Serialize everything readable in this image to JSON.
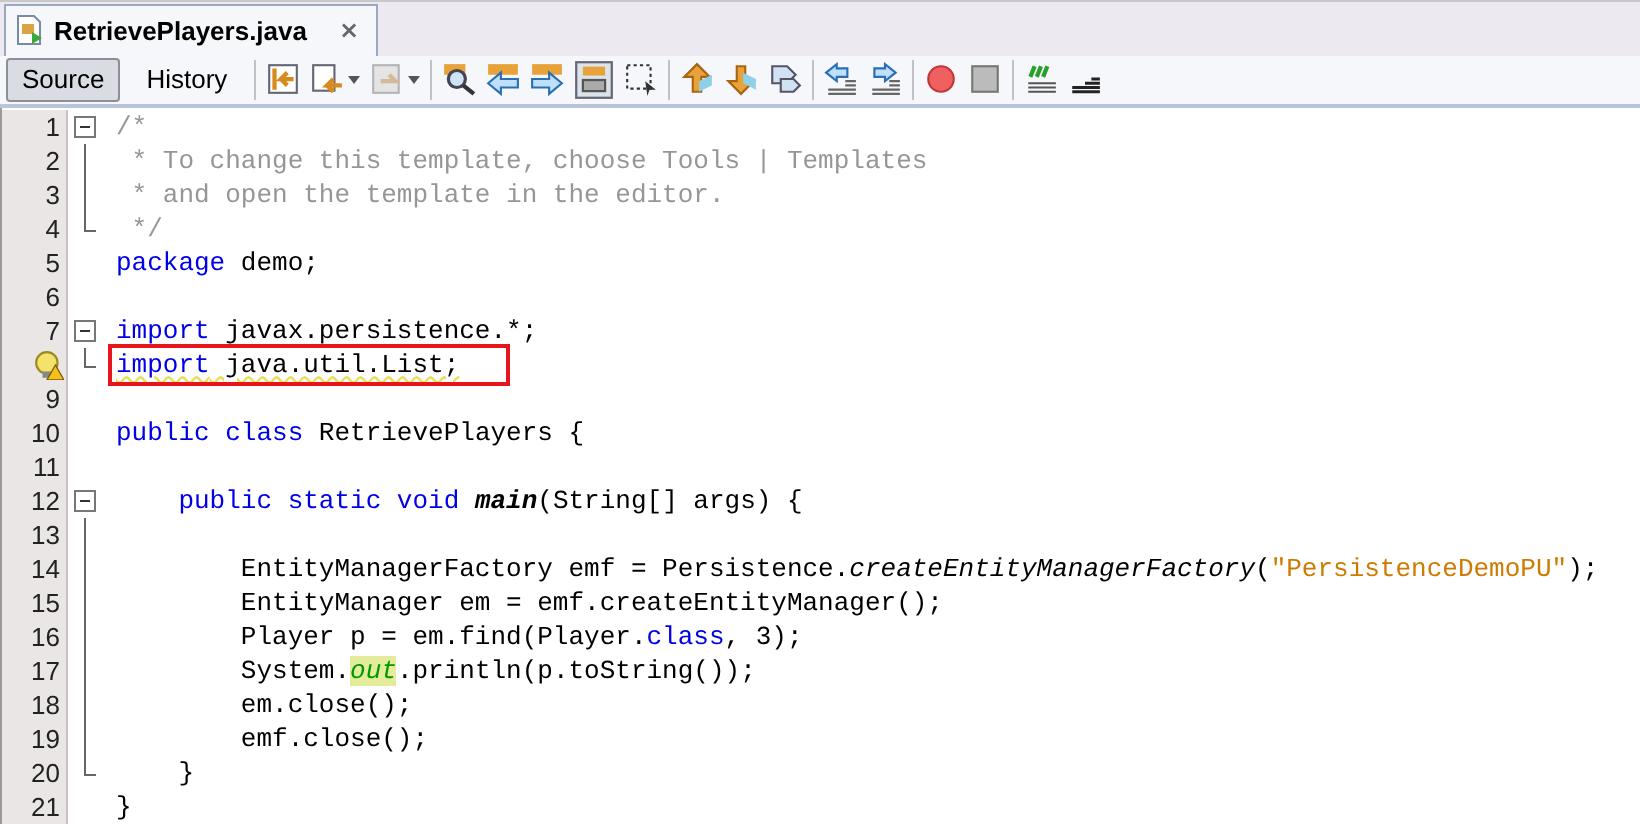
{
  "tab": {
    "title": "RetrievePlayers.java",
    "close": "×"
  },
  "view_buttons": [
    {
      "label": "Source",
      "selected": true
    },
    {
      "label": "History",
      "selected": false
    }
  ],
  "lines": [
    {
      "number": "1",
      "kind": "fold-start",
      "tokens": [
        {
          "kind": "comment",
          "text": "/*"
        }
      ]
    },
    {
      "number": "2",
      "kind": "fold-body",
      "tokens": [
        {
          "kind": "comment",
          "text": " * To change this template, choose Tools | Templates"
        }
      ]
    },
    {
      "number": "3",
      "kind": "fold-body",
      "tokens": [
        {
          "kind": "comment",
          "text": " * and open the template in the editor."
        }
      ]
    },
    {
      "number": "4",
      "kind": "fold-end",
      "tokens": [
        {
          "kind": "comment",
          "text": " */"
        }
      ]
    },
    {
      "number": "5",
      "kind": "plain",
      "tokens": [
        {
          "kind": "keyword",
          "text": "package"
        },
        {
          "kind": "plain",
          "text": " demo;"
        }
      ]
    },
    {
      "number": "6",
      "kind": "plain"
    },
    {
      "number": "7",
      "kind": "fold-start",
      "tokens": [
        {
          "kind": "keyword",
          "text": "import"
        },
        {
          "kind": "plain",
          "text": " javax.persistence.*;"
        }
      ]
    },
    {
      "kind": "fold-end",
      "warning": true,
      "boxed": true,
      "tokens": [
        {
          "kind": "keyword",
          "text": "import"
        },
        {
          "kind": "plain",
          "text": " java.util.List;"
        }
      ]
    },
    {
      "number": "9",
      "kind": "plain"
    },
    {
      "number": "10",
      "kind": "plain",
      "tokens": [
        {
          "kind": "keyword",
          "text": "public class"
        },
        {
          "kind": "plain",
          "text": " RetrievePlayers {"
        }
      ]
    },
    {
      "number": "11",
      "kind": "plain"
    },
    {
      "number": "12",
      "kind": "fold-start",
      "tokens": [
        {
          "kind": "keyword",
          "text": "    public static void "
        },
        {
          "kind": "declaration",
          "text": "main"
        },
        {
          "kind": "plain",
          "text": "(String[] args) {"
        }
      ]
    },
    {
      "number": "13",
      "kind": "fold-body"
    },
    {
      "number": "14",
      "kind": "fold-body",
      "tokens": [
        {
          "kind": "plain",
          "text": "        EntityManagerFactory emf = Persistence."
        },
        {
          "kind": "static",
          "text": "createEntityManagerFactory"
        },
        {
          "kind": "plain",
          "text": "("
        },
        {
          "kind": "string",
          "text": "\"PersistenceDemoPU\""
        },
        {
          "kind": "plain",
          "text": ");"
        }
      ]
    },
    {
      "number": "15",
      "kind": "fold-body",
      "tokens": [
        {
          "kind": "plain",
          "text": "        EntityManager em = emf.createEntityManager();"
        }
      ]
    },
    {
      "number": "16",
      "kind": "fold-body",
      "tokens": [
        {
          "kind": "plain",
          "text": "        Player p = em.find(Player."
        },
        {
          "kind": "keyword",
          "text": "class"
        },
        {
          "kind": "plain",
          "text": ", 3);"
        }
      ]
    },
    {
      "number": "17",
      "kind": "fold-body",
      "tokens": [
        {
          "kind": "plain",
          "text": "        System."
        },
        {
          "kind": "marked-field",
          "text": "out"
        },
        {
          "kind": "plain",
          "text": ".println(p.toString());"
        }
      ]
    },
    {
      "number": "18",
      "kind": "fold-body",
      "tokens": [
        {
          "kind": "plain",
          "text": "        em.close();"
        }
      ]
    },
    {
      "number": "19",
      "kind": "fold-body",
      "tokens": [
        {
          "kind": "plain",
          "text": "        emf.close();"
        }
      ]
    },
    {
      "number": "20",
      "kind": "fold-end",
      "tokens": [
        {
          "kind": "plain",
          "text": "    }"
        }
      ]
    },
    {
      "number": "21",
      "kind": "plain",
      "tokens": [
        {
          "kind": "plain",
          "text": "}"
        }
      ]
    }
  ]
}
